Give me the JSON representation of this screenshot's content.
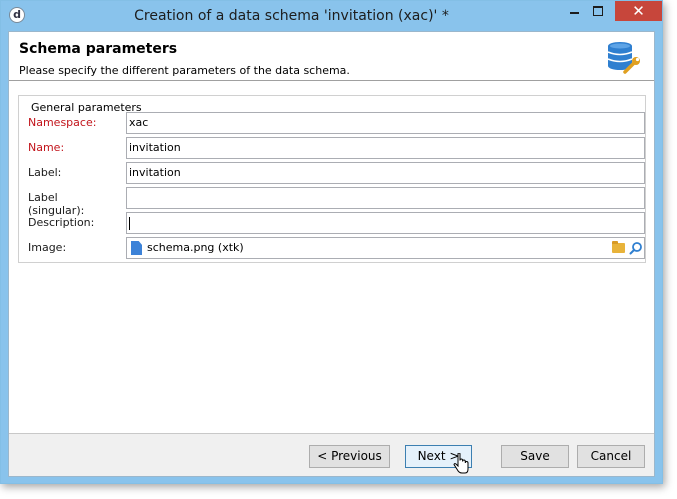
{
  "window": {
    "title": "Creation of a data schema 'invitation (xac)' *",
    "app_icon": "d",
    "close_glyph": "✕"
  },
  "header": {
    "title": "Schema parameters",
    "subtitle": "Please specify the different parameters of the data schema.",
    "icon": "database-wrench-icon"
  },
  "group": {
    "legend": "General parameters",
    "fields": [
      {
        "label": "Namespace:",
        "value": "xac",
        "required": true
      },
      {
        "label": "Name:",
        "value": "invitation",
        "required": true
      },
      {
        "label": "Label:",
        "value": "invitation",
        "required": false
      },
      {
        "label": "Label (singular):",
        "value": "",
        "required": false
      },
      {
        "label": "Description:",
        "value": "",
        "required": false
      },
      {
        "label": "Image:",
        "value": "schema.png (xtk)",
        "required": false
      }
    ]
  },
  "buttons": {
    "previous": "< Previous",
    "next": "Next >",
    "save": "Save",
    "cancel": "Cancel"
  },
  "colors": {
    "title_bar": "#89c3ec",
    "close_button": "#c7463b",
    "required_label": "#c2141b",
    "db_icon": "#2f7fd0",
    "wrench": "#e0a020"
  }
}
